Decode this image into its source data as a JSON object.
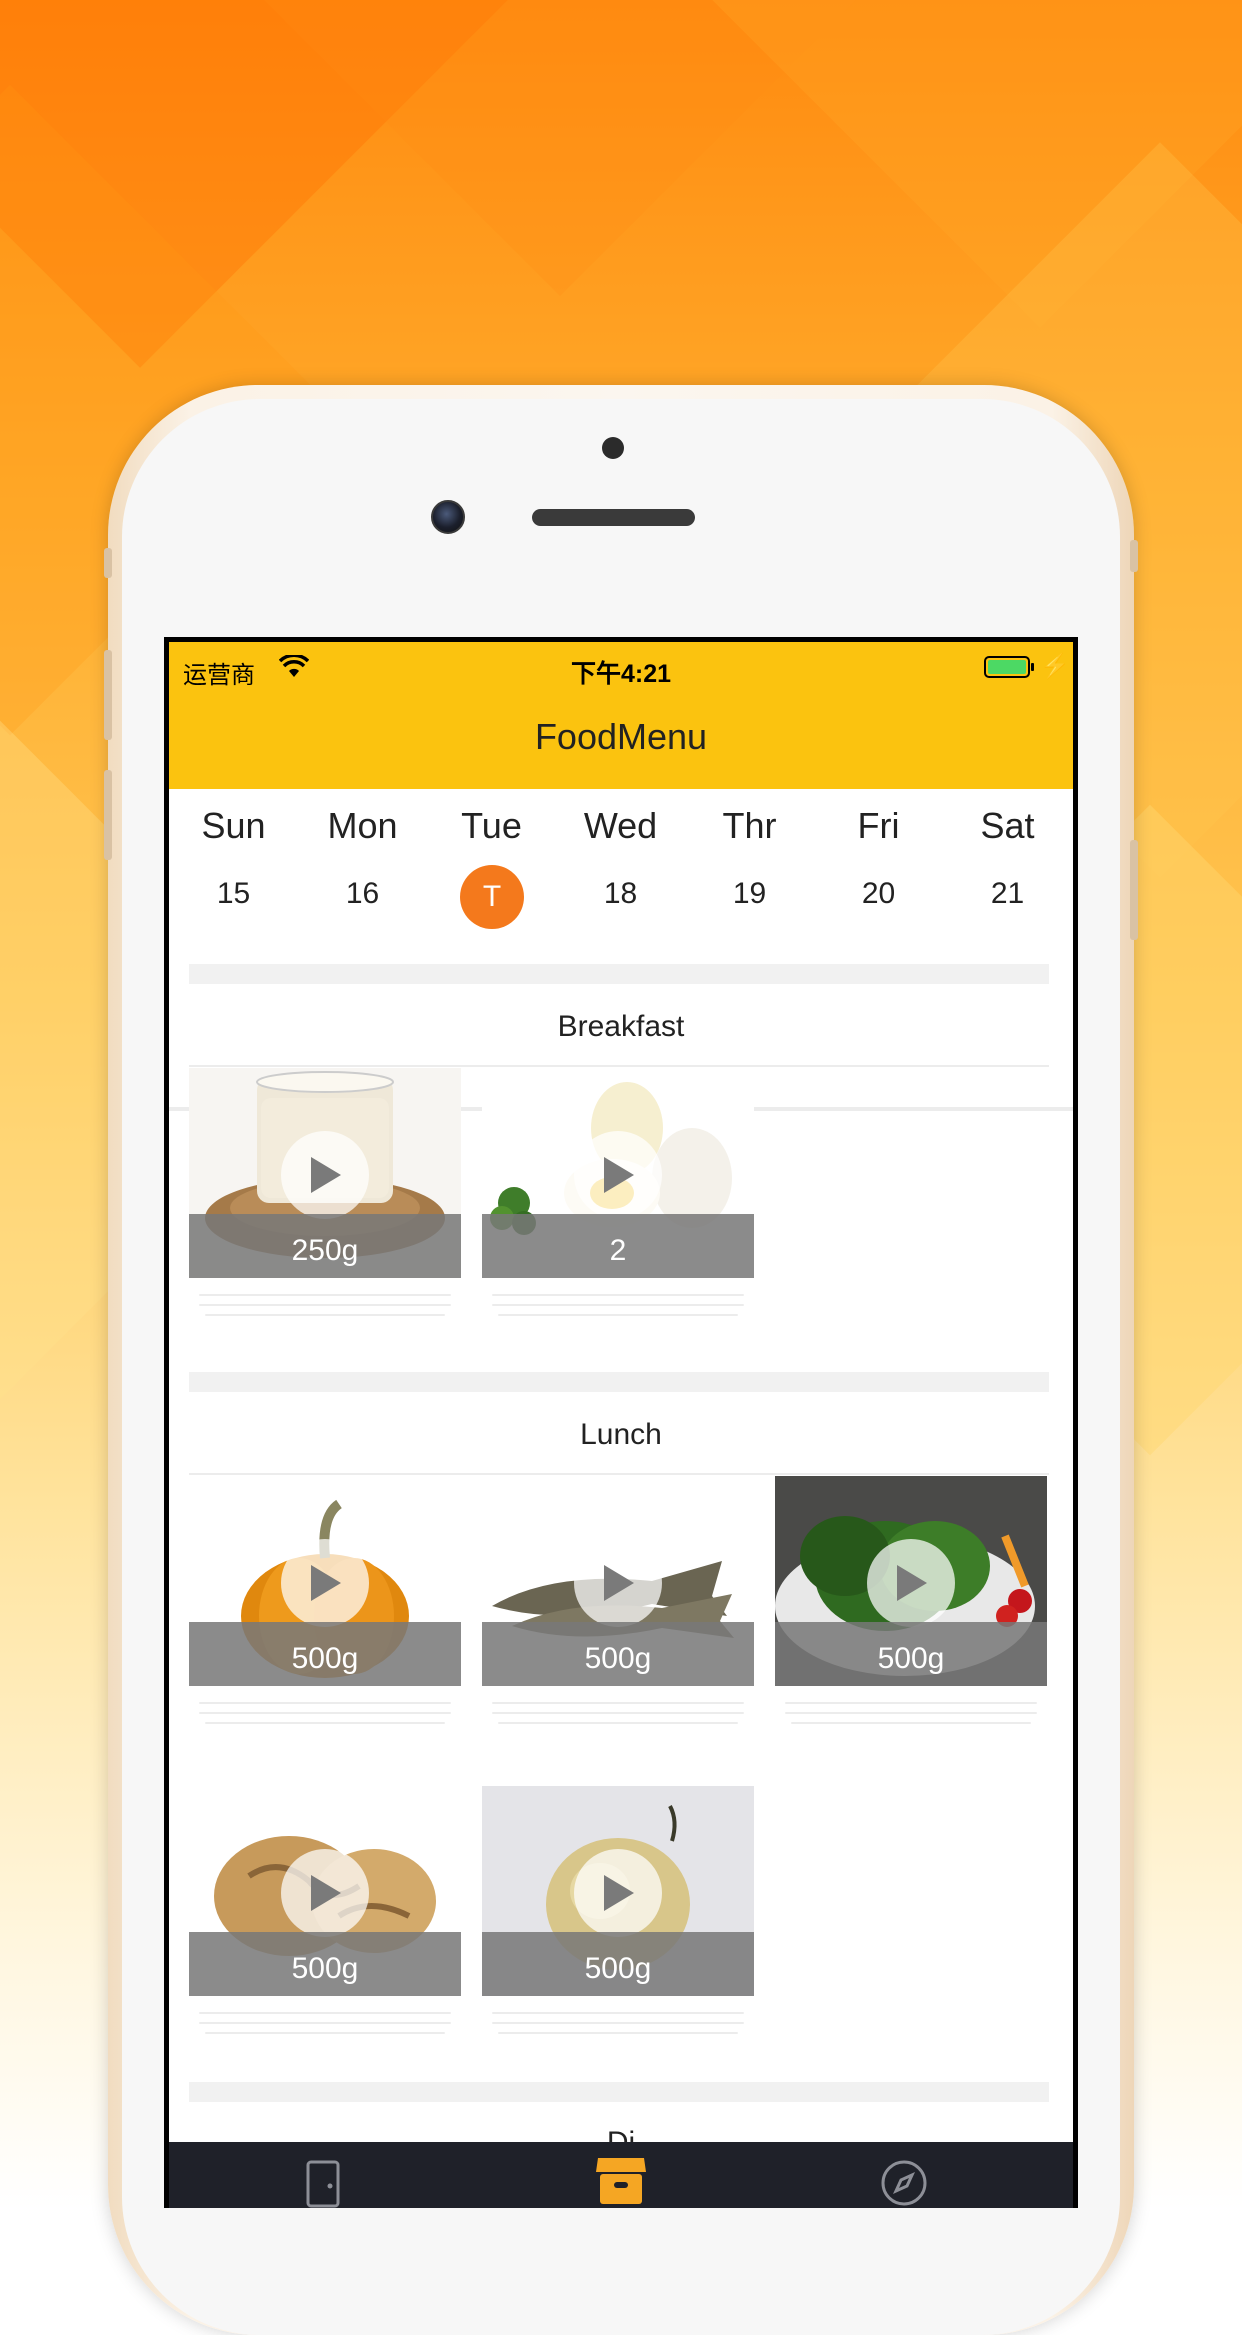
{
  "status": {
    "carrier": "运营商",
    "time": "下午4:21"
  },
  "nav": {
    "title": "FoodMenu"
  },
  "week": {
    "days": [
      {
        "name": "Sun",
        "num": "15"
      },
      {
        "name": "Mon",
        "num": "16"
      },
      {
        "name": "Tue",
        "num": "T",
        "selected": true
      },
      {
        "name": "Wed",
        "num": "18"
      },
      {
        "name": "Thr",
        "num": "19"
      },
      {
        "name": "Fri",
        "num": "20"
      },
      {
        "name": "Sat",
        "num": "21"
      }
    ]
  },
  "sections": [
    {
      "title": "Breakfast",
      "items": [
        {
          "food": "soy milk with soybeans",
          "amount": "250g"
        },
        {
          "food": "boiled eggs",
          "amount": "2"
        }
      ]
    },
    {
      "title": "Lunch",
      "items": [
        {
          "food": "pumpkin",
          "amount": "500g"
        },
        {
          "food": "fish",
          "amount": "500g"
        },
        {
          "food": "spinach",
          "amount": "500g"
        },
        {
          "food": "walnuts",
          "amount": "500g"
        },
        {
          "food": "pear",
          "amount": "500g"
        }
      ]
    },
    {
      "title": "Di"
    }
  ],
  "tabbar": {
    "tabs": [
      {
        "icon": "door-icon",
        "selected": false
      },
      {
        "icon": "store-icon",
        "selected": true
      },
      {
        "icon": "compass-icon",
        "selected": false
      }
    ]
  },
  "colors": {
    "accent": "#fbc30f",
    "selected_day": "#f4791c",
    "tab_active": "#f5a623"
  }
}
